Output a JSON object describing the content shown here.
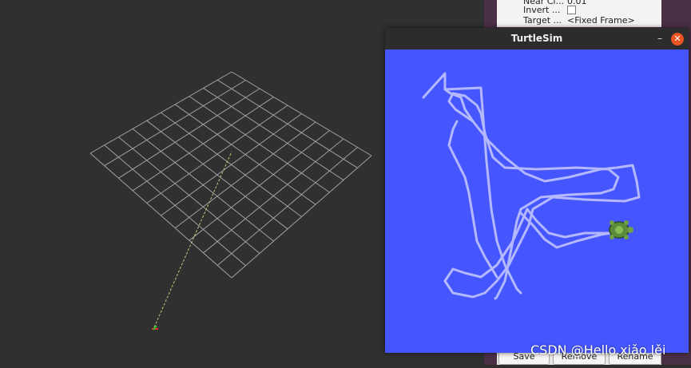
{
  "rviz": {
    "properties": [
      {
        "name": "Near Cl...",
        "value": "0.01"
      },
      {
        "name": "Invert ...",
        "value": ""
      },
      {
        "name": "Target ...",
        "value": "<Fixed Frame>"
      }
    ],
    "buttons": {
      "save": "Save",
      "remove": "Remove",
      "rename": "Rename"
    }
  },
  "turtlesim": {
    "title": "TurtleSim",
    "minimize_symbol": "–",
    "close_symbol": "✕",
    "background_color": "#4556ff",
    "pen_color": "#b3b8ff",
    "icons": {
      "turtle": "turtle-icon",
      "close": "close-icon",
      "minimize": "minimize-icon"
    }
  },
  "watermark": "CSDN @Hello.xiǎo lěi",
  "colors": {
    "grid": "#a0a0a0",
    "viewport_bg": "#303030",
    "accent": "#e95420"
  }
}
